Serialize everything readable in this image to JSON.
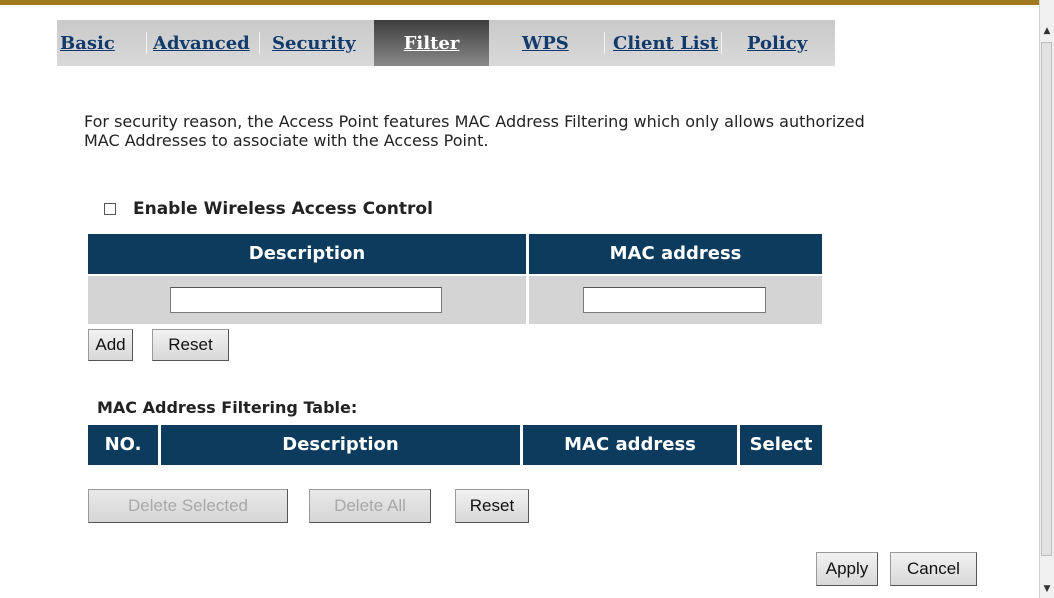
{
  "tabs": [
    {
      "label": "Basic",
      "active": false
    },
    {
      "label": "Advanced",
      "active": false
    },
    {
      "label": "Security",
      "active": false
    },
    {
      "label": "Filter",
      "active": true
    },
    {
      "label": "WPS",
      "active": false
    },
    {
      "label": "Client List",
      "active": false
    },
    {
      "label": "Policy",
      "active": false
    }
  ],
  "intro_text": "For security reason, the Access Point features MAC Address Filtering which only allows authorized MAC Addresses to associate with the Access Point.",
  "enable_control": {
    "label": "Enable Wireless Access Control",
    "checked": false
  },
  "entry_table": {
    "headers": [
      "Description",
      "MAC address"
    ],
    "description_value": "",
    "mac_value": ""
  },
  "entry_buttons": {
    "add": "Add",
    "reset": "Reset"
  },
  "filter_table": {
    "title": "MAC Address Filtering Table:",
    "headers": [
      "NO.",
      "Description",
      "MAC address",
      "Select"
    ],
    "rows": []
  },
  "table_buttons": {
    "delete_selected": "Delete Selected",
    "delete_all": "Delete All",
    "reset": "Reset"
  },
  "footer_buttons": {
    "apply": "Apply",
    "cancel": "Cancel"
  },
  "colors": {
    "header_bg": "#0d3b5e",
    "tab_text": "#123a6b",
    "accent_line": "#a07820"
  }
}
